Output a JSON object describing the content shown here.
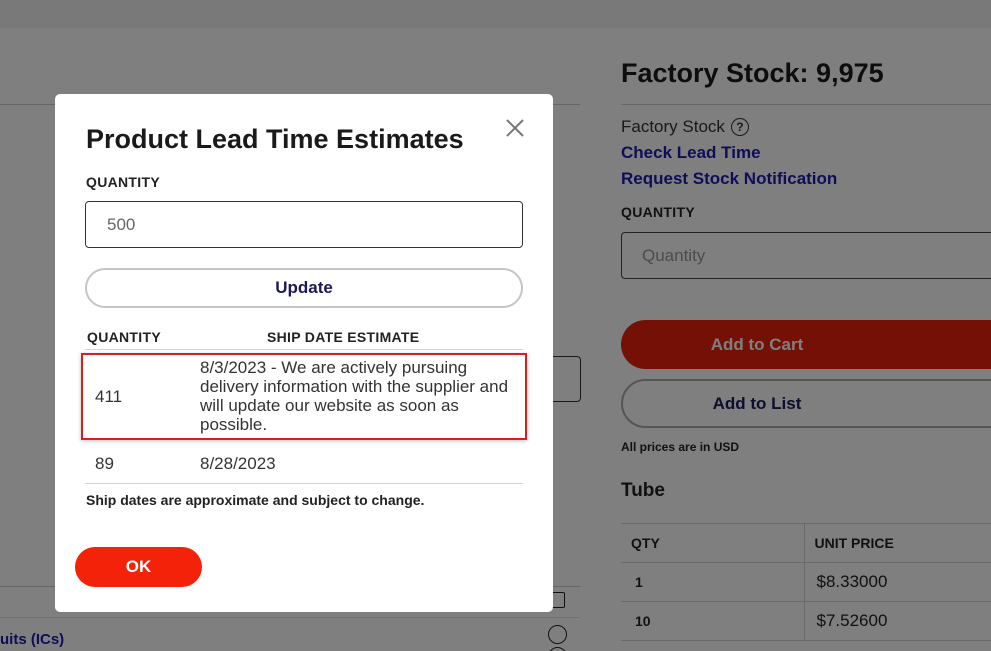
{
  "background": {
    "stock_title": "Factory Stock: 9,975",
    "factory_stock_label": "Factory Stock",
    "check_lead_time_link": "Check Lead Time",
    "request_stock_link": "Request Stock Notification",
    "quantity_label": "QUANTITY",
    "quantity_placeholder": "Quantity",
    "add_to_cart_label": "Add to Cart",
    "add_to_list_label": "Add to List",
    "usd_note": "All prices are in USD",
    "packaging_title": "Tube",
    "price_table": {
      "headers": [
        "QTY",
        "UNIT PRICE"
      ],
      "rows": [
        {
          "qty": "1",
          "price": "$8.33000"
        },
        {
          "qty": "10",
          "price": "$7.52600"
        }
      ]
    },
    "left_category_link": "uits (ICs)"
  },
  "modal": {
    "title": "Product Lead Time Estimates",
    "quantity_label": "QUANTITY",
    "quantity_value": "500",
    "update_label": "Update",
    "table_headers": {
      "quantity": "QUANTITY",
      "ship_date": "SHIP DATE ESTIMATE"
    },
    "rows": [
      {
        "quantity": "411",
        "ship_date": "8/3/2023 - We are actively pursuing delivery information with the supplier and will update our website as soon as possible."
      },
      {
        "quantity": "89",
        "ship_date": "8/28/2023"
      }
    ],
    "disclaimer": "Ship dates are approximate and subject to change.",
    "ok_label": "OK"
  },
  "icons": {
    "close": "close-icon",
    "help": "help-circle-icon"
  },
  "colors": {
    "primary_red": "#f5220a",
    "link_blue": "#1a1ab0",
    "highlight_border": "#d62020"
  }
}
